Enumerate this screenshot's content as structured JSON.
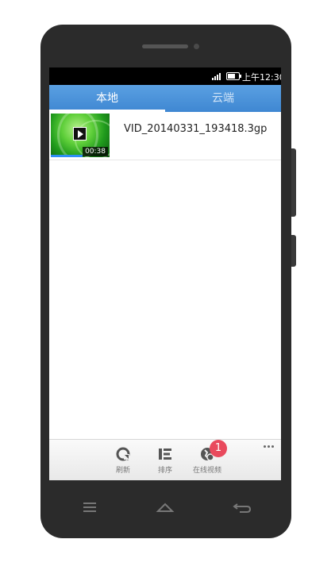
{
  "status_bar": {
    "time": "上午12:30",
    "signal_icon": "signal-bars-icon",
    "battery_icon": "battery-icon"
  },
  "tabs": [
    {
      "label": "本地",
      "active": true
    },
    {
      "label": "云端",
      "active": false
    }
  ],
  "videos": [
    {
      "filename": "VID_20140331_193418.3gp",
      "duration": "00:38",
      "thumbnail_icon": "play-icon"
    }
  ],
  "bottom_bar": {
    "refresh_label": "刷新",
    "sort_label": "排序",
    "online_label": "在线视频",
    "online_badge": "1",
    "more_icon": "more-dots-icon"
  },
  "nav_buttons": [
    "menu-icon",
    "home-icon",
    "back-icon"
  ],
  "colors": {
    "tab_bar": "#4a90d9",
    "badge": "#e94a5d",
    "progress": "#2f8ef5"
  }
}
